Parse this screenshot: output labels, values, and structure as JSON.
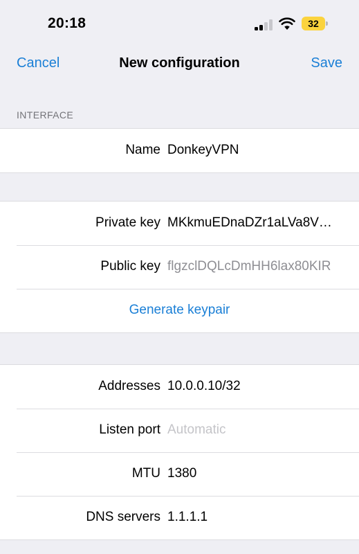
{
  "status_bar": {
    "time": "20:18",
    "battery": "32"
  },
  "nav": {
    "cancel_label": "Cancel",
    "title": "New configuration",
    "save_label": "Save"
  },
  "section": {
    "header": "INTERFACE"
  },
  "name_group": {
    "label": "Name",
    "value": "DonkeyVPN"
  },
  "keys_group": {
    "private_key_label": "Private key",
    "private_key_value": "MKkmuEDnaDZr1aLVa8V…",
    "public_key_label": "Public key",
    "public_key_value": "flgzclDQLcDmHH6lax80KIR",
    "generate_label": "Generate keypair"
  },
  "network_group": {
    "addresses_label": "Addresses",
    "addresses_value": "10.0.0.10/32",
    "listen_port_label": "Listen port",
    "listen_port_placeholder": "Automatic",
    "mtu_label": "MTU",
    "mtu_value": "1380",
    "dns_label": "DNS servers",
    "dns_value": "1.1.1.1"
  },
  "colors": {
    "accent": "#1a7fd6",
    "background": "#efeff4",
    "battery": "#fbd33d"
  },
  "icons": [
    "signal-icon",
    "wifi-icon",
    "battery-icon"
  ]
}
